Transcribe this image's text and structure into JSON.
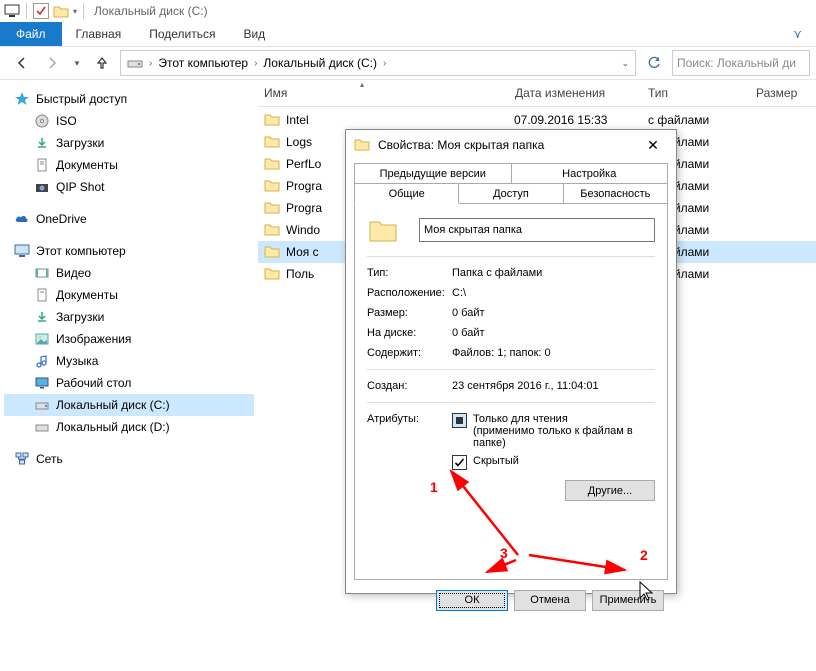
{
  "window": {
    "title": "Локальный диск (C:)"
  },
  "ribbon": {
    "file": "Файл",
    "tabs": [
      "Главная",
      "Поделиться",
      "Вид"
    ]
  },
  "breadcrumbs": [
    "Этот компьютер",
    "Локальный диск (C:)"
  ],
  "search_placeholder": "Поиск: Локальный ди",
  "columns": {
    "name": "Имя",
    "date": "Дата изменения",
    "type": "Тип",
    "size": "Размер"
  },
  "sidebar": {
    "quick": "Быстрый доступ",
    "quick_items": [
      "ISO",
      "Загрузки",
      "Документы",
      "QIP Shot"
    ],
    "onedrive": "OneDrive",
    "thispc": "Этот компьютер",
    "pc_items": [
      "Видео",
      "Документы",
      "Загрузки",
      "Изображения",
      "Музыка",
      "Рабочий стол",
      "Локальный диск (C:)",
      "Локальный диск (D:)"
    ],
    "network": "Сеть"
  },
  "rows": [
    {
      "n": "Intel",
      "d": "07.09.2016 15:33",
      "t": "с файлами"
    },
    {
      "n": "Logs",
      "d": "",
      "t": "с файлами"
    },
    {
      "n": "PerfLo",
      "d": "",
      "t": "с файлами"
    },
    {
      "n": "Progra",
      "d": "",
      "t": "с файлами"
    },
    {
      "n": "Progra",
      "d": "",
      "t": "с файлами"
    },
    {
      "n": "Windo",
      "d": "",
      "t": "с файлами"
    },
    {
      "n": "Моя с",
      "d": "",
      "t": "с файлами",
      "sel": true
    },
    {
      "n": "Поль",
      "d": "",
      "t": "с файлами"
    }
  ],
  "dialog": {
    "title": "Свойства: Моя скрытая папка",
    "tabs_top": [
      "Предыдущие версии",
      "Настройка"
    ],
    "tabs_bottom": [
      "Общие",
      "Доступ",
      "Безопасность"
    ],
    "name_value": "Моя скрытая папка",
    "fields": {
      "type_l": "Тип:",
      "type_v": "Папка с файлами",
      "loc_l": "Расположение:",
      "loc_v": "C:\\",
      "size_l": "Размер:",
      "size_v": "0 байт",
      "disk_l": "На диске:",
      "disk_v": "0 байт",
      "cont_l": "Содержит:",
      "cont_v": "Файлов: 1; папок: 0",
      "created_l": "Создан:",
      "created_v": "23 сентября 2016 г., 11:04:01",
      "attr_l": "Атрибуты:"
    },
    "readonly": "Только для чтения",
    "readonly2": "(применимо только к файлам в папке)",
    "hidden": "Скрытый",
    "other_btn": "Другие...",
    "ok": "ОК",
    "cancel": "Отмена",
    "apply": "Применить"
  },
  "annot": {
    "n1": "1",
    "n2": "2",
    "n3": "3"
  }
}
